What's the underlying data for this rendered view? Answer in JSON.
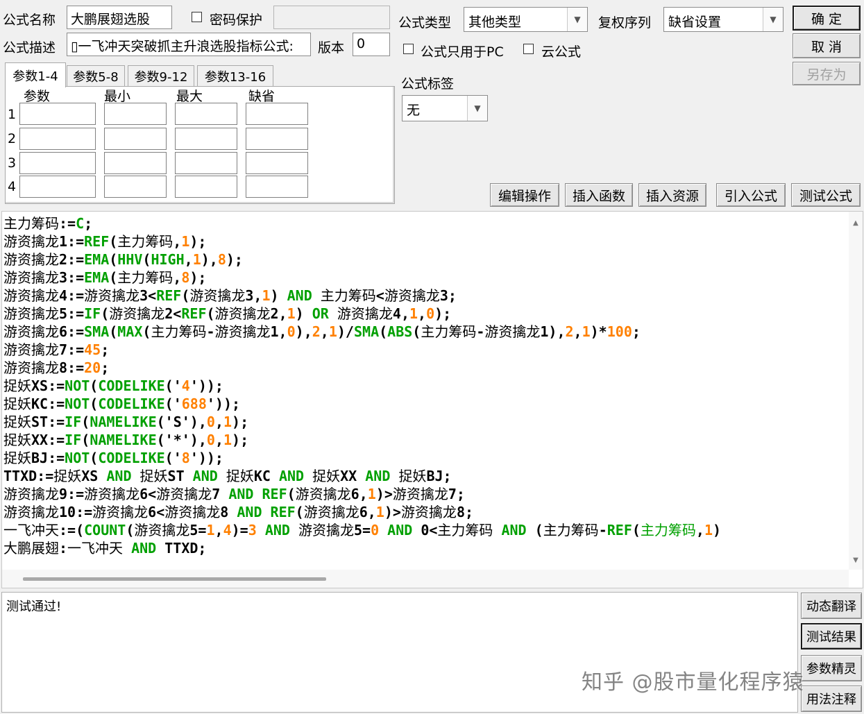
{
  "form": {
    "name_label": "公式名称",
    "name_value": "大鹏展翅选股",
    "password_label": "密码保护",
    "type_label": "公式类型",
    "type_value": "其他类型",
    "rights_label": "复权序列",
    "rights_value": "缺省设置",
    "desc_label": "公式描述",
    "desc_value": "▯一飞冲天突破抓主升浪选股指标公式:",
    "version_label": "版本",
    "version_value": "0",
    "pc_only_label": "公式只用于PC",
    "cloud_label": "云公式",
    "tag_label": "公式标签",
    "tag_value": "无"
  },
  "buttons": {
    "ok": "确 定",
    "cancel": "取 消",
    "save_as": "另存为",
    "edit_ops": "编辑操作",
    "insert_func": "插入函数",
    "insert_res": "插入资源",
    "import_formula": "引入公式",
    "test_formula": "测试公式",
    "dyn_translate": "动态翻译",
    "test_result": "测试结果",
    "param_wizard": "参数精灵",
    "usage_notes": "用法注释"
  },
  "tabs": [
    "参数1-4",
    "参数5-8",
    "参数9-12",
    "参数13-16"
  ],
  "params": {
    "headers": [
      "参数",
      "最小",
      "最大",
      "缺省"
    ],
    "rows": [
      "1",
      "2",
      "3",
      "4"
    ]
  },
  "code_lines": [
    [
      [
        "cn",
        "主力筹码"
      ],
      [
        "t",
        ":="
      ],
      [
        "fn",
        "C"
      ],
      [
        "t",
        ";"
      ]
    ],
    [
      [
        "cn",
        "游资擒龙"
      ],
      [
        "t",
        "1:="
      ],
      [
        "fn",
        "REF"
      ],
      [
        "t",
        "("
      ],
      [
        "cn",
        "主力筹码"
      ],
      [
        "t",
        ","
      ],
      [
        "num",
        "1"
      ],
      [
        "t",
        ");"
      ]
    ],
    [
      [
        "cn",
        "游资擒龙"
      ],
      [
        "t",
        "2:="
      ],
      [
        "fn",
        "EMA"
      ],
      [
        "t",
        "("
      ],
      [
        "fn",
        "HHV"
      ],
      [
        "t",
        "("
      ],
      [
        "fn",
        "HIGH"
      ],
      [
        "t",
        ","
      ],
      [
        "num",
        "1"
      ],
      [
        "t",
        "),"
      ],
      [
        "num",
        "8"
      ],
      [
        "t",
        ");"
      ]
    ],
    [
      [
        "cn",
        "游资擒龙"
      ],
      [
        "t",
        "3:="
      ],
      [
        "fn",
        "EMA"
      ],
      [
        "t",
        "("
      ],
      [
        "cn",
        "主力筹码"
      ],
      [
        "t",
        ","
      ],
      [
        "num",
        "8"
      ],
      [
        "t",
        ");"
      ]
    ],
    [
      [
        "cn",
        "游资擒龙"
      ],
      [
        "t",
        "4:="
      ],
      [
        "cn",
        "游资擒龙"
      ],
      [
        "t",
        "3<"
      ],
      [
        "fn",
        "REF"
      ],
      [
        "t",
        "("
      ],
      [
        "cn",
        "游资擒龙"
      ],
      [
        "t",
        "3,"
      ],
      [
        "num",
        "1"
      ],
      [
        "t",
        ") "
      ],
      [
        "kw",
        "AND"
      ],
      [
        "t",
        " "
      ],
      [
        "cn",
        "主力筹码"
      ],
      [
        "t",
        "<"
      ],
      [
        "cn",
        "游资擒龙"
      ],
      [
        "t",
        "3;"
      ]
    ],
    [
      [
        "cn",
        "游资擒龙"
      ],
      [
        "t",
        "5:="
      ],
      [
        "fn",
        "IF"
      ],
      [
        "t",
        "("
      ],
      [
        "cn",
        "游资擒龙"
      ],
      [
        "t",
        "2<"
      ],
      [
        "fn",
        "REF"
      ],
      [
        "t",
        "("
      ],
      [
        "cn",
        "游资擒龙"
      ],
      [
        "t",
        "2,"
      ],
      [
        "num",
        "1"
      ],
      [
        "t",
        ") "
      ],
      [
        "kw",
        "OR"
      ],
      [
        "t",
        " "
      ],
      [
        "cn",
        "游资擒龙"
      ],
      [
        "t",
        "4,"
      ],
      [
        "num",
        "1"
      ],
      [
        "t",
        ","
      ],
      [
        "num",
        "0"
      ],
      [
        "t",
        ");"
      ]
    ],
    [
      [
        "cn",
        "游资擒龙"
      ],
      [
        "t",
        "6:="
      ],
      [
        "fn",
        "SMA"
      ],
      [
        "t",
        "("
      ],
      [
        "fn",
        "MAX"
      ],
      [
        "t",
        "("
      ],
      [
        "cn",
        "主力筹码"
      ],
      [
        "t",
        "-"
      ],
      [
        "cn",
        "游资擒龙"
      ],
      [
        "t",
        "1,"
      ],
      [
        "num",
        "0"
      ],
      [
        "t",
        "),"
      ],
      [
        "num",
        "2"
      ],
      [
        "t",
        ","
      ],
      [
        "num",
        "1"
      ],
      [
        "t",
        ")/"
      ],
      [
        "fn",
        "SMA"
      ],
      [
        "t",
        "("
      ],
      [
        "fn",
        "ABS"
      ],
      [
        "t",
        "("
      ],
      [
        "cn",
        "主力筹码"
      ],
      [
        "t",
        "-"
      ],
      [
        "cn",
        "游资擒龙"
      ],
      [
        "t",
        "1),"
      ],
      [
        "num",
        "2"
      ],
      [
        "t",
        ","
      ],
      [
        "num",
        "1"
      ],
      [
        "t",
        ")*"
      ],
      [
        "num",
        "100"
      ],
      [
        "t",
        ";"
      ]
    ],
    [
      [
        "cn",
        "游资擒龙"
      ],
      [
        "t",
        "7:="
      ],
      [
        "num",
        "45"
      ],
      [
        "t",
        ";"
      ]
    ],
    [
      [
        "cn",
        "游资擒龙"
      ],
      [
        "t",
        "8:="
      ],
      [
        "num",
        "20"
      ],
      [
        "t",
        ";"
      ]
    ],
    [
      [
        "cn",
        "捉妖"
      ],
      [
        "t",
        "XS:="
      ],
      [
        "fn",
        "NOT"
      ],
      [
        "t",
        "("
      ],
      [
        "fn",
        "CODELIKE"
      ],
      [
        "t",
        "('"
      ],
      [
        "num",
        "4"
      ],
      [
        "t",
        "'));"
      ]
    ],
    [
      [
        "cn",
        "捉妖"
      ],
      [
        "t",
        "KC:="
      ],
      [
        "fn",
        "NOT"
      ],
      [
        "t",
        "("
      ],
      [
        "fn",
        "CODELIKE"
      ],
      [
        "t",
        "('"
      ],
      [
        "num",
        "688"
      ],
      [
        "t",
        "'));"
      ]
    ],
    [
      [
        "cn",
        "捉妖"
      ],
      [
        "t",
        "ST:="
      ],
      [
        "fn",
        "IF"
      ],
      [
        "t",
        "("
      ],
      [
        "fn",
        "NAMELIKE"
      ],
      [
        "t",
        "('S'),"
      ],
      [
        "num",
        "0"
      ],
      [
        "t",
        ","
      ],
      [
        "num",
        "1"
      ],
      [
        "t",
        ");"
      ]
    ],
    [
      [
        "cn",
        "捉妖"
      ],
      [
        "t",
        "XX:="
      ],
      [
        "fn",
        "IF"
      ],
      [
        "t",
        "("
      ],
      [
        "fn",
        "NAMELIKE"
      ],
      [
        "t",
        "('*'),"
      ],
      [
        "num",
        "0"
      ],
      [
        "t",
        ","
      ],
      [
        "num",
        "1"
      ],
      [
        "t",
        ");"
      ]
    ],
    [
      [
        "cn",
        "捉妖"
      ],
      [
        "t",
        "BJ:="
      ],
      [
        "fn",
        "NOT"
      ],
      [
        "t",
        "("
      ],
      [
        "fn",
        "CODELIKE"
      ],
      [
        "t",
        "('"
      ],
      [
        "num",
        "8"
      ],
      [
        "t",
        "'));"
      ]
    ],
    [
      [
        "t",
        "TTXD:="
      ],
      [
        "cn",
        "捉妖"
      ],
      [
        "t",
        "XS "
      ],
      [
        "kw",
        "AND"
      ],
      [
        "t",
        " "
      ],
      [
        "cn",
        "捉妖"
      ],
      [
        "t",
        "ST "
      ],
      [
        "kw",
        "AND"
      ],
      [
        "t",
        " "
      ],
      [
        "cn",
        "捉妖"
      ],
      [
        "t",
        "KC "
      ],
      [
        "kw",
        "AND"
      ],
      [
        "t",
        " "
      ],
      [
        "cn",
        "捉妖"
      ],
      [
        "t",
        "XX "
      ],
      [
        "kw",
        "AND"
      ],
      [
        "t",
        " "
      ],
      [
        "cn",
        "捉妖"
      ],
      [
        "t",
        "BJ;"
      ]
    ],
    [
      [
        "cn",
        "游资擒龙"
      ],
      [
        "t",
        "9:="
      ],
      [
        "cn",
        "游资擒龙"
      ],
      [
        "t",
        "6<"
      ],
      [
        "cn",
        "游资擒龙"
      ],
      [
        "t",
        "7 "
      ],
      [
        "kw",
        "AND"
      ],
      [
        "t",
        " "
      ],
      [
        "fn",
        "REF"
      ],
      [
        "t",
        "("
      ],
      [
        "cn",
        "游资擒龙"
      ],
      [
        "t",
        "6,"
      ],
      [
        "num",
        "1"
      ],
      [
        "t",
        ")>"
      ],
      [
        "cn",
        "游资擒龙"
      ],
      [
        "t",
        "7;"
      ]
    ],
    [
      [
        "cn",
        "游资擒龙"
      ],
      [
        "t",
        "10:="
      ],
      [
        "cn",
        "游资擒龙"
      ],
      [
        "t",
        "6<"
      ],
      [
        "cn",
        "游资擒龙"
      ],
      [
        "t",
        "8 "
      ],
      [
        "kw",
        "AND"
      ],
      [
        "t",
        " "
      ],
      [
        "fn",
        "REF"
      ],
      [
        "t",
        "("
      ],
      [
        "cn",
        "游资擒龙"
      ],
      [
        "t",
        "6,"
      ],
      [
        "num",
        "1"
      ],
      [
        "t",
        ")>"
      ],
      [
        "cn",
        "游资擒龙"
      ],
      [
        "t",
        "8;"
      ]
    ],
    [
      [
        "cn",
        "一飞冲天"
      ],
      [
        "t",
        ":=("
      ],
      [
        "fn",
        "COUNT"
      ],
      [
        "t",
        "("
      ],
      [
        "cn",
        "游资擒龙"
      ],
      [
        "t",
        "5="
      ],
      [
        "num",
        "1"
      ],
      [
        "t",
        ","
      ],
      [
        "num",
        "4"
      ],
      [
        "t",
        ")="
      ],
      [
        "num",
        "3"
      ],
      [
        "t",
        " "
      ],
      [
        "kw",
        "AND"
      ],
      [
        "t",
        " "
      ],
      [
        "cn",
        "游资擒龙"
      ],
      [
        "t",
        "5="
      ],
      [
        "num",
        "0"
      ],
      [
        "t",
        " "
      ],
      [
        "kw",
        "AND"
      ],
      [
        "t",
        " 0<"
      ],
      [
        "cn",
        "主力筹码"
      ],
      [
        "t",
        " "
      ],
      [
        "kw",
        "AND"
      ],
      [
        "t",
        " ("
      ],
      [
        "cn",
        "主力筹码"
      ],
      [
        "t",
        "-"
      ],
      [
        "fn",
        "REF"
      ],
      [
        "t",
        "("
      ],
      [
        "cm",
        "主力筹码"
      ],
      [
        "t",
        ","
      ],
      [
        "num",
        "1"
      ],
      [
        "t",
        ")"
      ]
    ],
    [
      [
        "cn",
        "大鹏展翅"
      ],
      [
        "t",
        ":"
      ],
      [
        "cn",
        "一飞冲天"
      ],
      [
        "t",
        " "
      ],
      [
        "kw",
        "AND"
      ],
      [
        "t",
        " TTXD;"
      ]
    ]
  ],
  "output": {
    "text": "测试通过!"
  },
  "watermark": "知乎 @股市量化程序猿"
}
